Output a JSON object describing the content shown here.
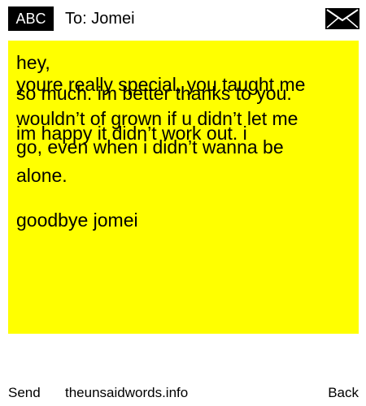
{
  "header": {
    "mode_label": "ABC",
    "to_label": "To: Jomei",
    "envelope_icon": "envelope-icon"
  },
  "note": {
    "background_color": "#ffff00",
    "lines": [
      "hey,",
      "youre really special, you taught me",
      "so much. im better thanks to you.",
      "wouldn’t of grown if u didn’t let me",
      "im happy it didn’t work out. i",
      "go, even when i didn’t wanna be",
      "alone.",
      "goodbye jomei"
    ]
  },
  "footer": {
    "send_label": "Send",
    "site_label": "theunsaidwords.info",
    "back_label": "Back"
  }
}
